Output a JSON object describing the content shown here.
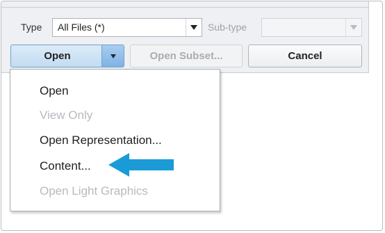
{
  "filters": {
    "type_label": "Type",
    "type_value": "All Files (*)",
    "subtype_label": "Sub-type",
    "subtype_value": ""
  },
  "buttons": {
    "open": "Open",
    "open_subset": "Open Subset...",
    "cancel": "Cancel"
  },
  "open_menu": {
    "items": [
      {
        "label": "Open",
        "enabled": true
      },
      {
        "label": "View Only",
        "enabled": false
      },
      {
        "label": "Open Representation...",
        "enabled": true
      },
      {
        "label": "Content...",
        "enabled": true
      },
      {
        "label": "Open Light Graphics",
        "enabled": false
      }
    ]
  },
  "colors": {
    "highlight_arrow": "#1a9bd7",
    "open_button": "#c3dcf2",
    "disabled_text": "#b6babf"
  },
  "icons": {
    "dropdown": "chevron-down-icon",
    "pointer": "arrow-left-icon"
  }
}
